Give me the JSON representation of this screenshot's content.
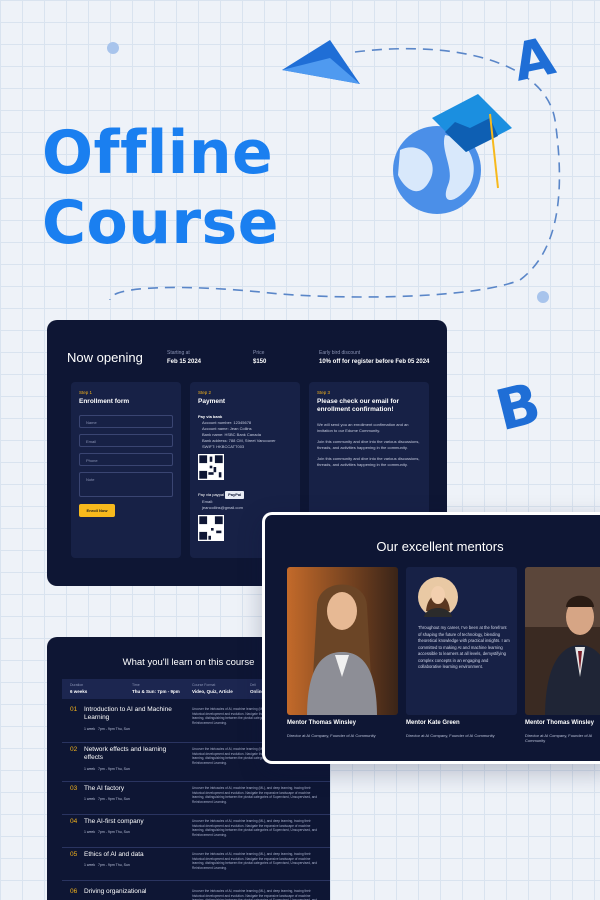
{
  "hero": {
    "line1": "Offline",
    "line2": "Course"
  },
  "deco": {
    "letter_a": "A",
    "letter_b": "B"
  },
  "colors": {
    "accent": "#1a7ff0",
    "card_bg": "#0e1634",
    "highlight": "#f7b91c"
  },
  "enroll": {
    "heading": "Now opening",
    "meta": [
      {
        "label": "Starting at",
        "value": "Feb 15 2024"
      },
      {
        "label": "Price",
        "value": "$150"
      },
      {
        "label": "Early bird discount",
        "value": "10% off for register before Feb 05 2024"
      }
    ],
    "steps": [
      {
        "label": "Step 1",
        "title": "Enrollment form",
        "fields": [
          "Name",
          "Email",
          "Phone",
          "Note"
        ],
        "button": "Enroll Now"
      },
      {
        "label": "Step 2",
        "title": "Payment",
        "bank_title": "Pay via bank",
        "bank_lines": [
          "Account number: 12345678",
          "Account name: Jean Collins",
          "Bank name: HSBC Bank Canada",
          "Bank address: 788 CM, Street Vancouver",
          "SWIFT: HKBCCATT003"
        ],
        "paypal_title": "Pay via paypal",
        "paypal_badge": "PayPal",
        "email_label": "Email:",
        "email": "jeancollins@gmail.com"
      },
      {
        "label": "Step 3",
        "title": "Please check our email for enrollment confirmation!",
        "p1": "We will send you an enrollment confirmation and an invitation to our Edume Community.",
        "p2": "Join this community and dive into the various discussions, threads, and activities happening in the community.",
        "p3": "Join this community and dive into the various discussions, threads, and activities happening in the community."
      }
    ]
  },
  "mentors": {
    "title": "Our excellent mentors",
    "list": [
      {
        "name": "Mentor Thomas Winsley",
        "role": "Director at AI Company, Founder of AI Community"
      },
      {
        "name": "Mentor Kate Green",
        "role": "Director at AI Company, Founder of AI Community",
        "bio": "Throughout my career, I've been at the forefront of shaping the future of technology, blending theoretical knowledge with practical insights. I am committed to making AI and machine learning accessible to learners at all levels, demystifying complex concepts in an engaging and collaborative learning environment."
      },
      {
        "name": "Mentor Thomas Winsley",
        "role": "Director at AI Company, Founder of AI Community"
      }
    ]
  },
  "course": {
    "title": "What you'll learn on this course",
    "head": [
      {
        "label": "Duration",
        "value": "6 weeks"
      },
      {
        "label": "Time",
        "value": "Thu & Sun: 7pm - 9pm"
      },
      {
        "label": "Course Format",
        "value": "Video, Quiz, Article"
      },
      {
        "label": "Deli",
        "value": "Online"
      }
    ],
    "week_label": "1 week",
    "time_label": "7pm - 9pm Thu, Sun",
    "desc": "Uncover the intricacies of AI, machine learning (ML), and deep learning, tracing their historical development and evolution. Navigate the expansive landscape of machine learning, distinguishing between the pivotal categories of Supervised, Unsupervised, and Reinforcement Learning.",
    "rows": [
      {
        "num": "01",
        "title": "Introduction to AI and Machine Learning"
      },
      {
        "num": "02",
        "title": "Network effects and learning effects"
      },
      {
        "num": "03",
        "title": "The AI factory"
      },
      {
        "num": "04",
        "title": "The AI-first company"
      },
      {
        "num": "05",
        "title": "Ethics of AI and data"
      },
      {
        "num": "06",
        "title": "Driving organizational"
      }
    ]
  }
}
